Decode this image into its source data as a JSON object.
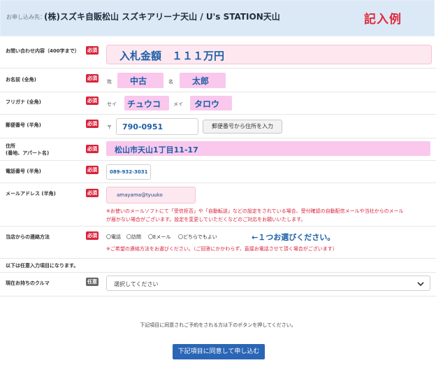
{
  "header": {
    "label": "お申し込み先：",
    "dealer": "(株)スズキ自販松山 スズキアリーナ天山 / U's STATION天山",
    "example_tag": "記入例"
  },
  "badges": {
    "required": "必須",
    "optional": "任意"
  },
  "inquiry": {
    "label": "お問い合わせ内容（400字まで）",
    "value": "入札金額　１１１万円"
  },
  "name": {
    "label": "お名前 (全角)",
    "sei_label": "姓",
    "sei": "中古",
    "mei_label": "名",
    "mei": "太郎"
  },
  "kana": {
    "label": "フリガナ (全角)",
    "sei_label": "セイ",
    "sei": "チュウコ",
    "mei_label": "メイ",
    "mei": "タロウ"
  },
  "postal": {
    "label": "郵便番号 (半角)",
    "prefix": "〒",
    "value": "790-0951",
    "button": "郵便番号から住所を入力"
  },
  "address": {
    "label_line1": "住所",
    "label_line2": "(番地、アパート名)",
    "value": "松山市天山1丁目11-17"
  },
  "phone": {
    "label": "電話番号 (半角)",
    "value": "089-932-3031"
  },
  "email": {
    "label": "メールアドレス (半角)",
    "value": "amayama@tyuuko",
    "note_line1": "※お使いのメールソフトにて「受信拒否」や「自動転送」などの設定をされている場合、受付確認の自動配信メールや当社からのメール",
    "note_line2": "が届かない場合がございます。設定を変更していただくなどのご対応をお願いいたします。"
  },
  "contact": {
    "label": "当店からの連絡方法",
    "options": [
      "〇電話",
      "〇訪問",
      "〇Eメール",
      "〇どちらでもよい"
    ],
    "hint": "←１つお選びください。",
    "note": "※ご希望の連絡方法をお選びください。（ご回答にかかわらず、直接お電話させて頂く場合がございます）"
  },
  "optional_notice": "以下は任意入力項目になります。",
  "car": {
    "label": "現在お持ちのクルマ",
    "placeholder": "選択してください"
  },
  "footer": {
    "note": "下記項目に同意されご予約をされる方は下のボタンを押してください。",
    "submit": "下記項目に同意して申し込む"
  }
}
